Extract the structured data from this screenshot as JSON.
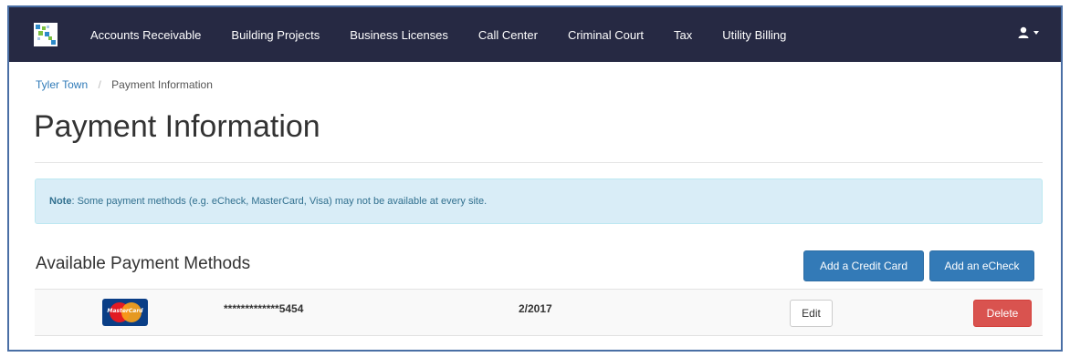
{
  "navbar": {
    "items": [
      {
        "label": "Accounts Receivable"
      },
      {
        "label": "Building Projects"
      },
      {
        "label": "Business Licenses"
      },
      {
        "label": "Call Center"
      },
      {
        "label": "Criminal Court"
      },
      {
        "label": "Tax"
      },
      {
        "label": "Utility Billing"
      }
    ],
    "user_icon": "user-icon",
    "background": "#262943"
  },
  "breadcrumb": {
    "home": "Tyler Town",
    "separator": "/",
    "current": "Payment Information"
  },
  "page": {
    "title": "Payment Information"
  },
  "alert": {
    "label": "Note",
    "text": ": Some payment methods (e.g. eCheck, MasterCard, Visa) may not be available at every site."
  },
  "payment_methods": {
    "title": "Available Payment Methods",
    "add_credit_card_label": "Add a Credit Card",
    "add_echeck_label": "Add an eCheck",
    "rows": [
      {
        "card_brand_icon": "mastercard-icon",
        "card_brand_text": "MasterCard",
        "card_number": "*************5454",
        "expiration": "2/2017",
        "edit_label": "Edit",
        "delete_label": "Delete"
      }
    ]
  },
  "colors": {
    "primary": "#337ab7",
    "danger": "#d9534f",
    "info_bg": "#d9edf7",
    "link": "#2f7ab8"
  }
}
